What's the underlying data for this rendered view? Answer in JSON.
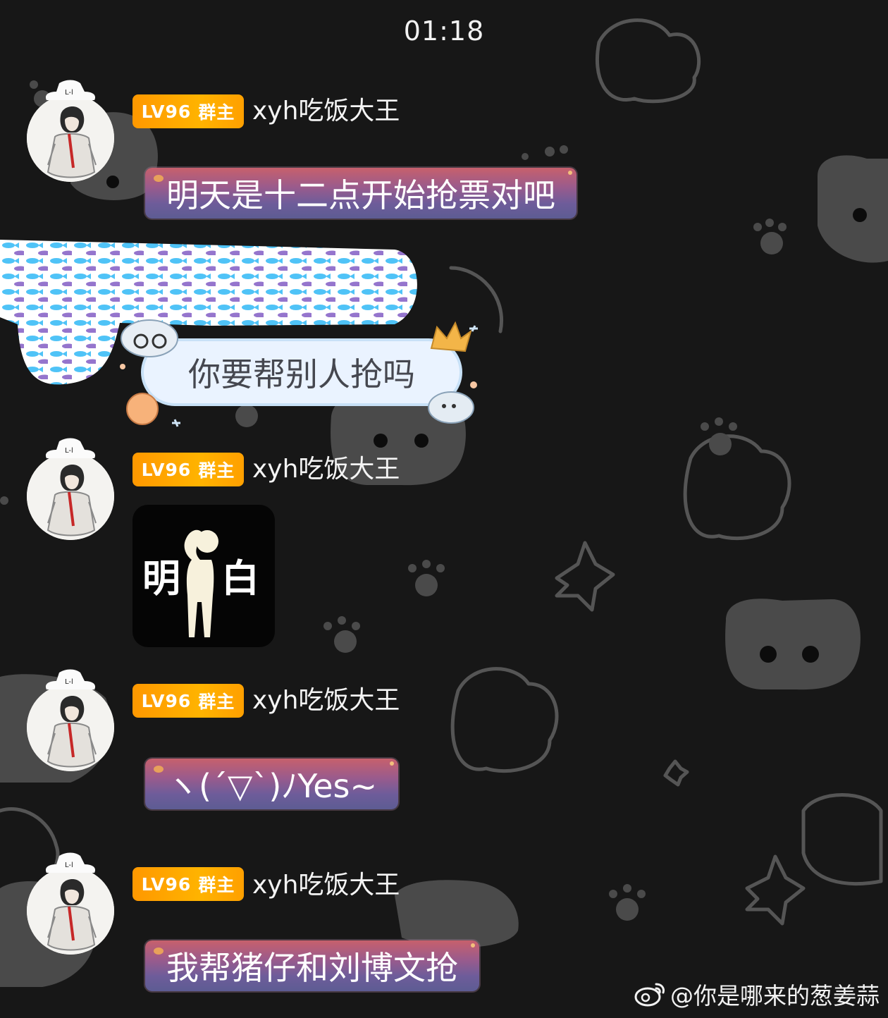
{
  "status": {
    "time": "01:18"
  },
  "messages": [
    {
      "badge_level": "LV96",
      "badge_role": "群主",
      "sender": "xyh吃饭大王",
      "type": "text",
      "text": "明天是十二点开始抢票对吧"
    },
    {
      "type": "text",
      "text": "你要帮别人抢吗",
      "sender_hidden": true
    },
    {
      "badge_level": "LV96",
      "badge_role": "群主",
      "sender": "xyh吃饭大王",
      "type": "sticker",
      "sticker_left": "明",
      "sticker_right": "白"
    },
    {
      "badge_level": "LV96",
      "badge_role": "群主",
      "sender": "xyh吃饭大王",
      "type": "text",
      "text": "ヽ(´▽`)ﾉYes~"
    },
    {
      "badge_level": "LV96",
      "badge_role": "群主",
      "sender": "xyh吃饭大王",
      "type": "text",
      "text": "我帮猪仔和刘博文抢"
    }
  ],
  "watermark": {
    "icon": "weibo-icon",
    "text": "@你是哪来的葱姜蒜"
  },
  "colors": {
    "background": "#171717",
    "badge": "#ffa000",
    "bubble_top": "#c7606c",
    "bubble_bottom": "#5d5c93",
    "blue_bubble": "#eaf3ff"
  }
}
